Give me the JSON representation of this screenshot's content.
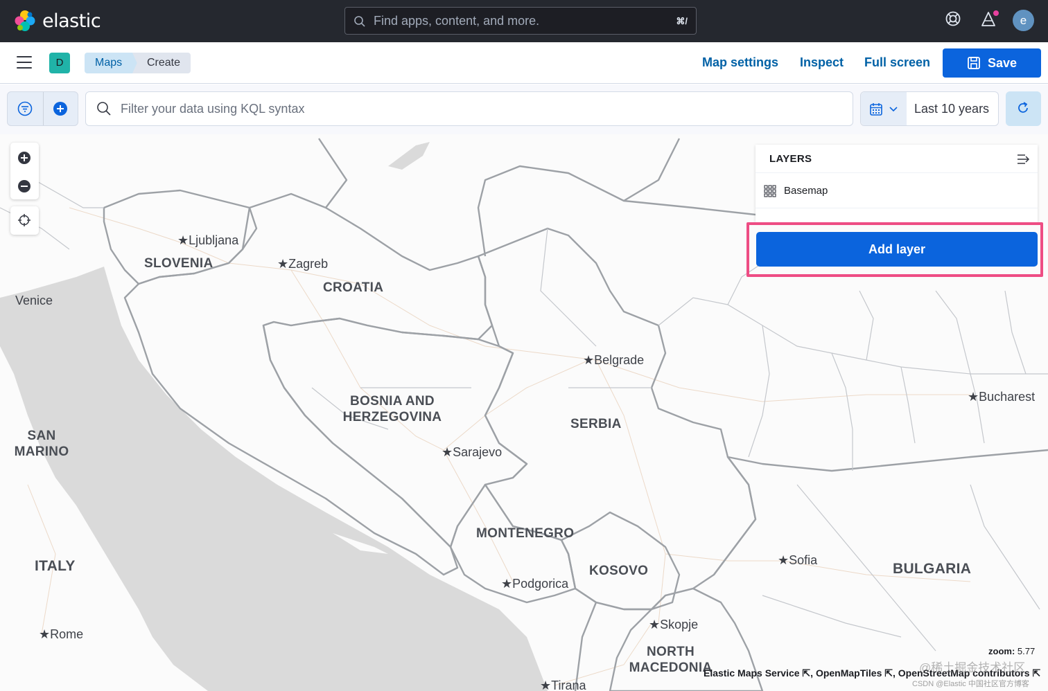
{
  "header": {
    "brand": "elastic",
    "search_placeholder": "Find apps, content, and more.",
    "search_shortcut": "⌘/",
    "avatar_initial": "e"
  },
  "appbar": {
    "space_initial": "D",
    "breadcrumbs": [
      "Maps",
      "Create"
    ],
    "links": [
      "Map settings",
      "Inspect",
      "Full screen"
    ],
    "save_label": "Save"
  },
  "query": {
    "placeholder": "Filter your data using KQL syntax",
    "time_range": "Last 10 years"
  },
  "map": {
    "countries": [
      {
        "name": "SLOVENIA"
      },
      {
        "name": "CROATIA"
      },
      {
        "name": "BOSNIA AND HERZEGOVINA"
      },
      {
        "name": "SERBIA"
      },
      {
        "name": "MONTENEGRO"
      },
      {
        "name": "KOSOVO"
      },
      {
        "name": "BULGARIA"
      },
      {
        "name": "ITALY"
      },
      {
        "name": "SAN MARINO"
      },
      {
        "name": "NORTH MACEDONIA"
      }
    ],
    "cities": [
      "Ljubljana",
      "Zagreb",
      "Venice",
      "Belgrade",
      "Bucharest",
      "Sarajevo",
      "Podgorica",
      "Sofia",
      "Skopje",
      "Rome",
      "Tirana"
    ],
    "zoom_label": "zoom:",
    "zoom_value": "5.77",
    "attribution": [
      "Elastic Maps Service",
      "OpenMapTiles",
      "OpenStreetMap contributors"
    ],
    "watermark": "@稀土掘金技术社区",
    "watermark_sub": "CSDN @Elastic 中国社区官方博客"
  },
  "layers_panel": {
    "title": "LAYERS",
    "items": [
      {
        "name": "Basemap",
        "icon": "grid-icon"
      }
    ],
    "add_button": "Add layer"
  },
  "colors": {
    "header_bg": "#25282f",
    "primary": "#0b64dd",
    "link": "#0061a6",
    "highlight": "#ee4d84",
    "sea": "#dadada"
  }
}
